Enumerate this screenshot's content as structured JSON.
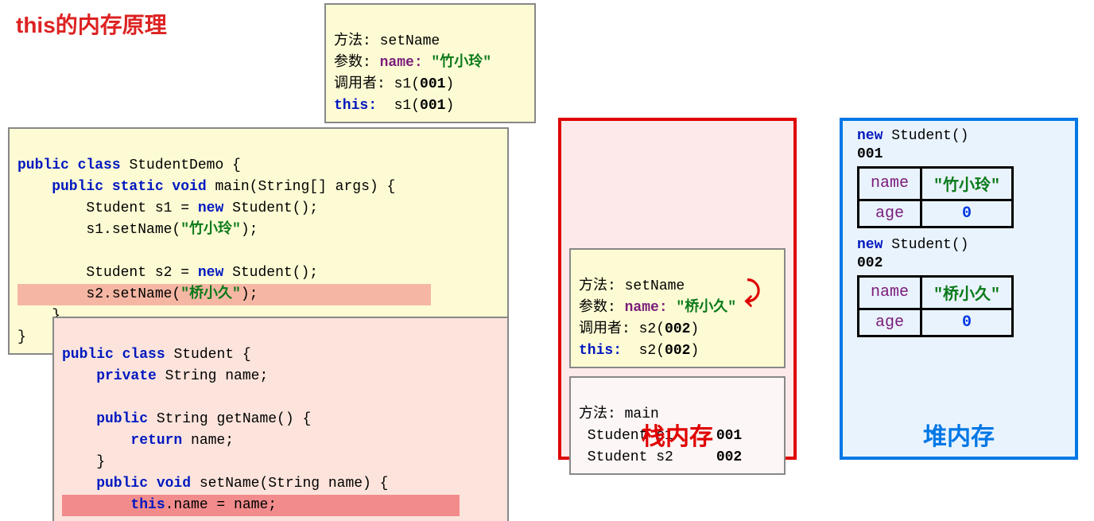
{
  "title": "this的内存原理",
  "topFrame": {
    "l1a": "方法: ",
    "l1b": "setName",
    "l2a": "参数: ",
    "l2b": "name:",
    "l2c": " \"竹小玲\"",
    "l3a": "调用者: ",
    "l3b": "s1(",
    "l3c": "001",
    "l3d": ")",
    "l4a": "this:",
    "l4b": "  s1(",
    "l4c": "001",
    "l4d": ")"
  },
  "code1": {
    "l1a": "public class ",
    "l1b": "StudentDemo {",
    "l2a": "    public static void ",
    "l2b": "main(String[] args) {",
    "l3a": "        Student s1 = ",
    "l3b": "new ",
    "l3c": "Student();",
    "l4a": "        s1.setName(",
    "l4b": "\"竹小玲\"",
    "l4c": ");",
    "blank": "",
    "l5a": "        Student s2 = ",
    "l5b": "new ",
    "l5c": "Student();",
    "l6a": "        s2.setName(",
    "l6b": "\"桥小久\"",
    "l6c": ");",
    "l7": "    }",
    "l8": "}"
  },
  "code2": {
    "l1a": "public class ",
    "l1b": "Student {",
    "l2a": "    private ",
    "l2b": "String name;",
    "blank": "",
    "l3a": "    public ",
    "l3b": "String getName() {",
    "l4a": "        return ",
    "l4b": "name;",
    "l5": "    }",
    "l6a": "    public void ",
    "l6b": "setName(String name) {",
    "l7a": "        this",
    "l7b": ".name = name;"
  },
  "stack": {
    "label": "栈内存",
    "frame2": {
      "l1a": "方法: ",
      "l1b": "setName",
      "l2a": "参数: ",
      "l2b": "name:",
      "l2c": " \"桥小久\"",
      "l3a": "调用者: ",
      "l3b": "s2(",
      "l3c": "002",
      "l3d": ")",
      "l4a": "this:",
      "l4b": "  s2(",
      "l4c": "002",
      "l4d": ")"
    },
    "frame1": {
      "l1": "方法: main",
      "l2a": " Student s1     ",
      "l2b": "001",
      "l3a": " Student s2     ",
      "l3b": "002"
    }
  },
  "heap": {
    "label": "堆内存",
    "obj1": {
      "newLabel1": "new",
      "newLabel2": " Student()",
      "addr": "001",
      "nameKey": "name",
      "nameVal": "\"竹小玲\"",
      "ageKey": "age",
      "ageVal": "0"
    },
    "obj2": {
      "newLabel1": "new",
      "newLabel2": " Student()",
      "addr": "002",
      "nameKey": "name",
      "nameVal": "\"桥小久\"",
      "ageKey": "age",
      "ageVal": "0"
    }
  },
  "arrow": "⤸"
}
